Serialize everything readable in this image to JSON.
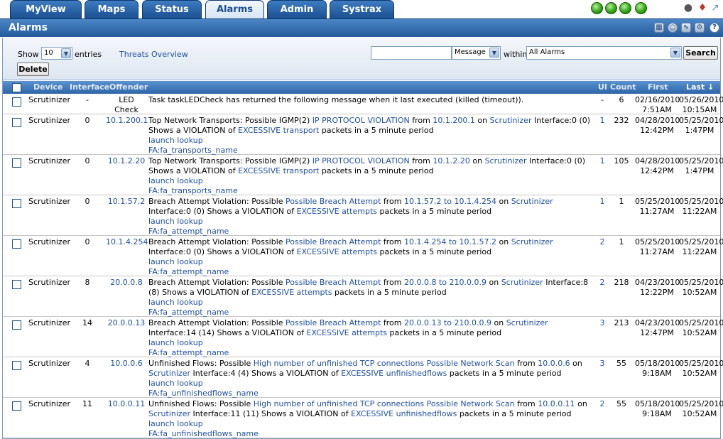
{
  "tabs": [
    {
      "label": "MyView"
    },
    {
      "label": "Maps"
    },
    {
      "label": "Status"
    },
    {
      "label": "Alarms",
      "active": true
    },
    {
      "label": "Admin"
    },
    {
      "label": "Systrax"
    }
  ],
  "status_icons": [
    "green-orb",
    "green-orb",
    "green-orb",
    "green-orb"
  ],
  "top_right_icons": [
    "binoculars-icon",
    "pin-icon",
    "tools-icon"
  ],
  "panel": {
    "title": "Alarms",
    "header_icons": [
      "print-icon",
      "settings-icon",
      "rss-icon",
      "options-icon",
      "help-icon"
    ]
  },
  "toolbar": {
    "show_label": "Show",
    "entries_value": "10",
    "entries_label": "entries",
    "threats_link": "Threats Overview",
    "search_value": "",
    "field_select": "Message",
    "within_label": "within",
    "scope_select": "All Alarms",
    "search_button": "Search",
    "delete_button": "Delete"
  },
  "table": {
    "headers": {
      "device": "Device",
      "interface": "Interface",
      "offender": "Offender",
      "ui": "UI",
      "count": "Count",
      "first": "First",
      "last": "Last ↓"
    },
    "rows": [
      {
        "device": "Scrutinizer",
        "interface": "-",
        "offender": "LED Check",
        "offender_link": false,
        "msg": [
          {
            "t": "Task taskLEDCheck has returned the following message when it last executed (killed (timeout)).",
            "l": false
          }
        ],
        "extra": [],
        "ui": "-",
        "ui_link": false,
        "count": "6",
        "first": [
          "02/16/2010",
          "7:51AM"
        ],
        "last": [
          "05/26/2010",
          "10:15AM"
        ]
      },
      {
        "device": "Scrutinizer",
        "interface": "0",
        "offender": "10.1.200.1",
        "offender_link": true,
        "msg": [
          {
            "t": "Top Network Transports: Possible IGMP(2) ",
            "l": false
          },
          {
            "t": "IP PROTOCOL VIOLATION",
            "l": true
          },
          {
            "t": " from ",
            "l": false
          },
          {
            "t": "10.1.200.1",
            "l": true
          },
          {
            "t": " on ",
            "l": false
          },
          {
            "t": "Scrutinizer",
            "l": true
          },
          {
            "t": " Interface:0 (0) Shows a VIOLATION of ",
            "l": false
          },
          {
            "t": "EXCESSIVE transport",
            "l": true
          },
          {
            "t": " packets in a 5 minute period",
            "l": false
          }
        ],
        "extra": [
          "launch lookup",
          "FA:fa_transports_name"
        ],
        "ui": "1",
        "ui_link": true,
        "count": "232",
        "first": [
          "04/28/2010",
          "12:42PM"
        ],
        "last": [
          "05/25/2010",
          "1:47PM"
        ]
      },
      {
        "device": "Scrutinizer",
        "interface": "0",
        "offender": "10.1.2.20",
        "offender_link": true,
        "msg": [
          {
            "t": "Top Network Transports: Possible IGMP(2) ",
            "l": false
          },
          {
            "t": "IP PROTOCOL VIOLATION",
            "l": true
          },
          {
            "t": " from ",
            "l": false
          },
          {
            "t": "10.1.2.20",
            "l": true
          },
          {
            "t": " on ",
            "l": false
          },
          {
            "t": "Scrutinizer",
            "l": true
          },
          {
            "t": " Interface:0 (0) Shows a VIOLATION of ",
            "l": false
          },
          {
            "t": "EXCESSIVE transport",
            "l": true
          },
          {
            "t": " packets in a 5 minute period",
            "l": false
          }
        ],
        "extra": [
          "launch lookup",
          "FA:fa_transports_name"
        ],
        "ui": "1",
        "ui_link": true,
        "count": "105",
        "first": [
          "04/28/2010",
          "12:42PM"
        ],
        "last": [
          "05/25/2010",
          "1:47PM"
        ]
      },
      {
        "device": "Scrutinizer",
        "interface": "0",
        "offender": "10.1.57.2",
        "offender_link": true,
        "msg": [
          {
            "t": "Breach Attempt Violation: Possible ",
            "l": false
          },
          {
            "t": "Possible Breach Attempt",
            "l": true
          },
          {
            "t": " from ",
            "l": false
          },
          {
            "t": "10.1.57.2 to 10.1.4.254",
            "l": true
          },
          {
            "t": " on ",
            "l": false
          },
          {
            "t": "Scrutinizer",
            "l": true
          },
          {
            "t": " Interface:0 (0) Shows a VIOLATION of ",
            "l": false
          },
          {
            "t": "EXCESSIVE attempts",
            "l": true
          },
          {
            "t": " packets in a 5 minute period",
            "l": false
          }
        ],
        "extra": [
          "launch lookup",
          "FA:fa_attempt_name"
        ],
        "ui": "1",
        "ui_link": true,
        "count": "1",
        "first": [
          "05/25/2010",
          "11:27AM"
        ],
        "last": [
          "05/25/2010",
          "11:22AM"
        ]
      },
      {
        "device": "Scrutinizer",
        "interface": "0",
        "offender": "10.1.4.254",
        "offender_link": true,
        "msg": [
          {
            "t": "Breach Attempt Violation: Possible ",
            "l": false
          },
          {
            "t": "Possible Breach Attempt",
            "l": true
          },
          {
            "t": " from ",
            "l": false
          },
          {
            "t": "10.1.4.254 to 10.1.57.2",
            "l": true
          },
          {
            "t": " on ",
            "l": false
          },
          {
            "t": "Scrutinizer",
            "l": true
          },
          {
            "t": " Interface:0 (0) Shows a VIOLATION of ",
            "l": false
          },
          {
            "t": "EXCESSIVE attempts",
            "l": true
          },
          {
            "t": " packets in a 5 minute period",
            "l": false
          }
        ],
        "extra": [
          "launch lookup",
          "FA:fa_attempt_name"
        ],
        "ui": "2",
        "ui_link": true,
        "count": "1",
        "first": [
          "05/25/2010",
          "11:27AM"
        ],
        "last": [
          "05/25/2010",
          "11:22AM"
        ]
      },
      {
        "device": "Scrutinizer",
        "interface": "8",
        "offender": "20.0.0.8",
        "offender_link": true,
        "msg": [
          {
            "t": "Breach Attempt Violation: Possible ",
            "l": false
          },
          {
            "t": "Possible Breach Attempt",
            "l": true
          },
          {
            "t": " from ",
            "l": false
          },
          {
            "t": "20.0.0.8 to 210.0.0.9",
            "l": true
          },
          {
            "t": " on ",
            "l": false
          },
          {
            "t": "Scrutinizer",
            "l": true
          },
          {
            "t": " Interface:8 (8) Shows a VIOLATION of ",
            "l": false
          },
          {
            "t": "EXCESSIVE attempts",
            "l": true
          },
          {
            "t": " packets in a 5 minute period",
            "l": false
          }
        ],
        "extra": [
          "launch lookup",
          "FA:fa_attempt_name"
        ],
        "ui": "2",
        "ui_link": true,
        "count": "218",
        "first": [
          "04/23/2010",
          "12:22PM"
        ],
        "last": [
          "05/25/2010",
          "10:52AM"
        ]
      },
      {
        "device": "Scrutinizer",
        "interface": "14",
        "offender": "20.0.0.13",
        "offender_link": true,
        "msg": [
          {
            "t": "Breach Attempt Violation: Possible ",
            "l": false
          },
          {
            "t": "Possible Breach Attempt",
            "l": true
          },
          {
            "t": " from ",
            "l": false
          },
          {
            "t": "20.0.0.13 to 210.0.0.9",
            "l": true
          },
          {
            "t": " on ",
            "l": false
          },
          {
            "t": "Scrutinizer",
            "l": true
          },
          {
            "t": " Interface:14 (14) Shows a VIOLATION of ",
            "l": false
          },
          {
            "t": "EXCESSIVE attempts",
            "l": true
          },
          {
            "t": " packets in a 5 minute period",
            "l": false
          }
        ],
        "extra": [
          "launch lookup",
          "FA:fa_attempt_name"
        ],
        "ui": "3",
        "ui_link": true,
        "count": "213",
        "first": [
          "04/23/2010",
          "12:47PM"
        ],
        "last": [
          "05/25/2010",
          "10:52AM"
        ]
      },
      {
        "device": "Scrutinizer",
        "interface": "4",
        "offender": "10.0.0.6",
        "offender_link": true,
        "msg": [
          {
            "t": "Unfinished Flows: Possible ",
            "l": false
          },
          {
            "t": "High number of unfinished TCP connections Possible Network Scan",
            "l": true
          },
          {
            "t": " from ",
            "l": false
          },
          {
            "t": "10.0.0.6",
            "l": true
          },
          {
            "t": " on ",
            "l": false
          },
          {
            "t": "Scrutinizer",
            "l": true
          },
          {
            "t": " Interface:4 (4) Shows a VIOLATION of ",
            "l": false
          },
          {
            "t": "EXCESSIVE unfinishedflows",
            "l": true
          },
          {
            "t": " packets in a 5 minute period",
            "l": false
          }
        ],
        "extra": [
          "launch lookup",
          "FA:fa_unfinishedflows_name"
        ],
        "ui": "3",
        "ui_link": true,
        "count": "55",
        "first": [
          "05/18/2010",
          "9:18AM"
        ],
        "last": [
          "05/25/2010",
          "10:52AM"
        ]
      },
      {
        "device": "Scrutinizer",
        "interface": "11",
        "offender": "10.0.0.11",
        "offender_link": true,
        "msg": [
          {
            "t": "Unfinished Flows: Possible ",
            "l": false
          },
          {
            "t": "High number of unfinished TCP connections Possible Network Scan",
            "l": true
          },
          {
            "t": " from ",
            "l": false
          },
          {
            "t": "10.0.0.11",
            "l": true
          },
          {
            "t": " on ",
            "l": false
          },
          {
            "t": "Scrutinizer",
            "l": true
          },
          {
            "t": " Interface:11 (11) Shows a VIOLATION of ",
            "l": false
          },
          {
            "t": "EXCESSIVE unfinishedflows",
            "l": true
          },
          {
            "t": " packets in a 5 minute period",
            "l": false
          }
        ],
        "extra": [
          "launch lookup",
          "FA:fa_unfinishedflows_name"
        ],
        "ui": "2",
        "ui_link": true,
        "count": "55",
        "first": [
          "05/18/2010",
          "9:18AM"
        ],
        "last": [
          "05/25/2010",
          "10:52AM"
        ]
      }
    ]
  }
}
